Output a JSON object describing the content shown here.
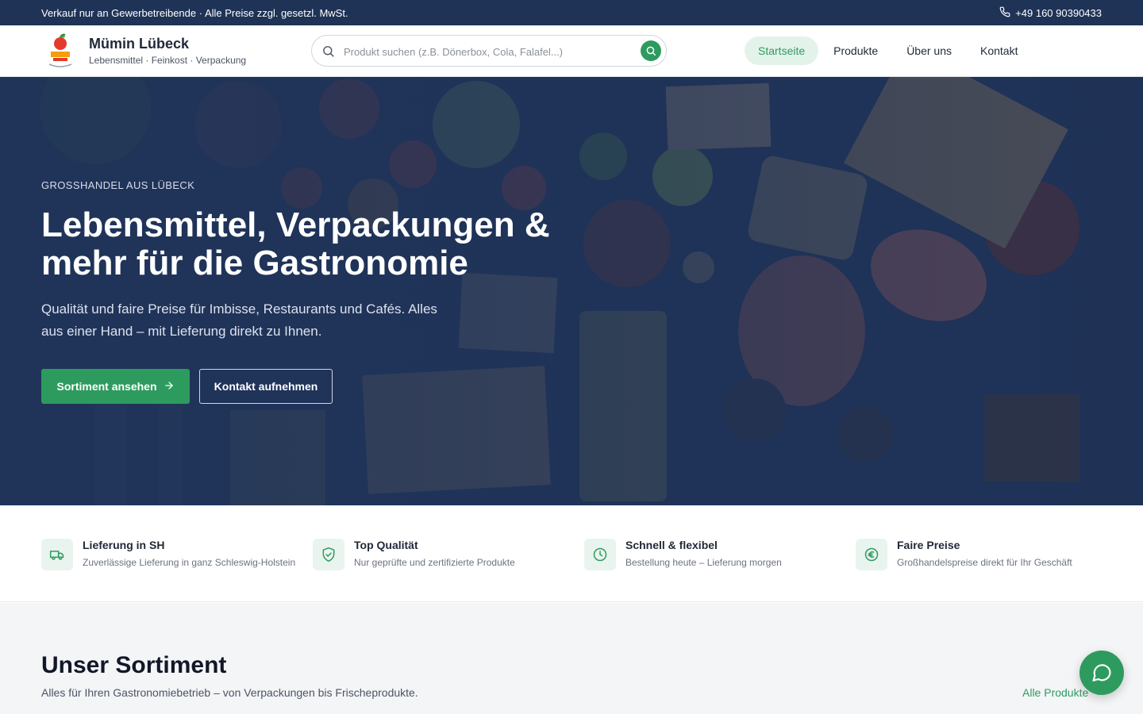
{
  "topbar": {
    "notice": "Verkauf nur an Gewerbetreibende · Alle Preise zzgl. gesetzl. MwSt.",
    "phone": "+49 160 90390433"
  },
  "header": {
    "brand_name": "Mümin Lübeck",
    "brand_tagline": "Lebensmittel · Feinkost · Verpackung",
    "search_placeholder": "Produkt suchen (z.B. Dönerbox, Cola, Falafel...)",
    "nav": [
      {
        "label": "Startseite",
        "active": true
      },
      {
        "label": "Produkte",
        "active": false
      },
      {
        "label": "Über uns",
        "active": false
      },
      {
        "label": "Kontakt",
        "active": false
      }
    ]
  },
  "hero": {
    "eyebrow": "GROSSHANDEL AUS LÜBECK",
    "title": "Lebensmittel, Verpackungen & mehr für die Gastronomie",
    "subtitle": "Qualität und faire Preise für Imbisse, Restaurants und Cafés. Alles aus einer Hand – mit Lieferung direkt zu Ihnen.",
    "primary_button": "Sortiment ansehen",
    "secondary_button": "Kontakt aufnehmen"
  },
  "features": [
    {
      "icon": "truck-icon",
      "title": "Lieferung in SH",
      "description": "Zuverlässige Lieferung in ganz Schleswig-Holstein"
    },
    {
      "icon": "shield-check-icon",
      "title": "Top Qualität",
      "description": "Nur geprüfte und zertifizierte Produkte"
    },
    {
      "icon": "clock-icon",
      "title": "Schnell & flexibel",
      "description": "Bestellung heute – Lieferung morgen"
    },
    {
      "icon": "euro-icon",
      "title": "Faire Preise",
      "description": "Großhandelspreise direkt für Ihr Geschäft"
    }
  ],
  "sortiment": {
    "heading": "Unser Sortiment",
    "subtitle": "Alles für Ihren Gastronomiebetrieb – von Verpackungen bis Frischeprodukte.",
    "all_link": "Alle Produkte"
  },
  "colors": {
    "topbar": "#1e3356",
    "accent": "#2e9b5e",
    "hero_overlay": "#20345a"
  }
}
